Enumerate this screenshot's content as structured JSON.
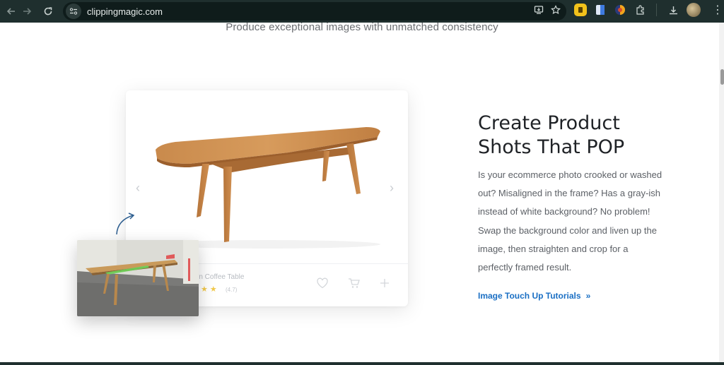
{
  "browser": {
    "url": "clippingmagic.com",
    "nav": {
      "back": "back-icon",
      "forward": "forward-icon",
      "reload": "reload-icon"
    },
    "omnibox_icons": [
      "install-app-icon",
      "bookmark-star-icon"
    ],
    "extensions": [
      "extension-yellow-icon",
      "extension-doc-icon",
      "extension-colorful-icon",
      "extensions-puzzle-icon"
    ],
    "toolbar_icons": [
      "download-icon",
      "profile-avatar",
      "menu-icon"
    ]
  },
  "page": {
    "tagline": "Produce exceptional images with unmatched consistency",
    "headline": [
      "Create Product",
      "Shots That POP"
    ],
    "description": [
      "Is your ecommerce photo crooked or washed",
      "out? Misaligned in the frame? Has a gray-ish",
      "instead of white background? No problem!",
      "Swap the background color and liven up the",
      "image, then straighten and crop for a",
      "perfectly framed result."
    ],
    "link": {
      "label": "Image Touch Up Tutorials",
      "chevron": "»"
    },
    "card": {
      "product_name": "rn Coffee Table",
      "stars": "★ ★",
      "rating": "(4.7)",
      "actions": [
        "heart-icon",
        "cart-icon",
        "plus-icon"
      ],
      "prev": "‹",
      "next": "›"
    },
    "colors": {
      "accent_link": "#1a6fc4",
      "headline": "#1f2226",
      "body_text": "#5c6066",
      "chrome_bg": "#1f2f2e"
    }
  }
}
